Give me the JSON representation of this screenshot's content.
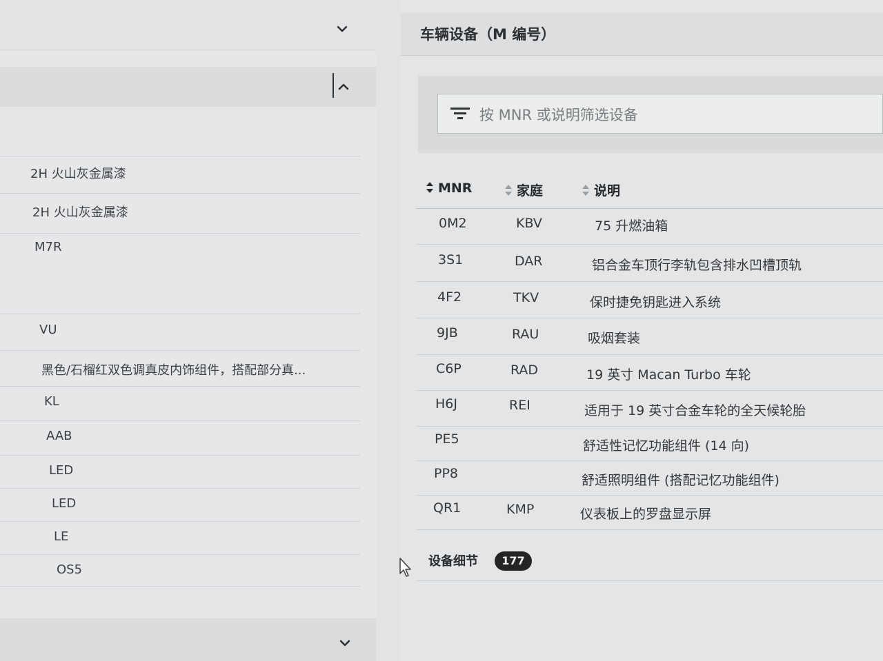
{
  "left_panel": {
    "values": [
      "2H 火山灰金属漆",
      "2H 火山灰金属漆",
      "M7R",
      "VU",
      "黑色/石榴红双色调真皮内饰组件，搭配部分真...",
      "KL",
      "AAB",
      "LED",
      "LED",
      "LE",
      "OS5"
    ]
  },
  "vehicle_equipment": {
    "title": "车辆设备（M 编号）",
    "filter_placeholder": "按 MNR 或说明筛选设备",
    "columns": [
      "MNR",
      "家庭",
      "说明"
    ],
    "rows": [
      {
        "mnr": "0M2",
        "family": "KBV",
        "desc": "75 升燃油箱"
      },
      {
        "mnr": "3S1",
        "family": "DAR",
        "desc": "铝合金车顶行李轨包含排水凹槽顶轨"
      },
      {
        "mnr": "4F2",
        "family": "TKV",
        "desc": "保时捷免钥匙进入系统"
      },
      {
        "mnr": "9JB",
        "family": "RAU",
        "desc": "吸烟套装"
      },
      {
        "mnr": "C6P",
        "family": "RAD",
        "desc": "19 英寸 Macan Turbo 车轮"
      },
      {
        "mnr": "H6J",
        "family": "REI",
        "desc": "适用于 19 英寸合金车轮的全天候轮胎"
      },
      {
        "mnr": "PE5",
        "family": "",
        "desc": "舒适性记忆功能组件 (14 向)"
      },
      {
        "mnr": "PP8",
        "family": "",
        "desc": "舒适照明组件 (搭配记忆功能组件)"
      },
      {
        "mnr": "QR1",
        "family": "KMP",
        "desc": "仪表板上的罗盘显示屏"
      }
    ],
    "details_label": "设备细节",
    "details_count": "177"
  },
  "icons": {
    "chevron_down": "chevron-down-icon",
    "chevron_up": "chevron-up-icon",
    "filter": "filter-icon",
    "sort": "sort-icon",
    "cursor": "mouse-cursor-icon"
  },
  "colors": {
    "badge_bg": "#222426",
    "panel_bg": "#e4e5e6"
  }
}
